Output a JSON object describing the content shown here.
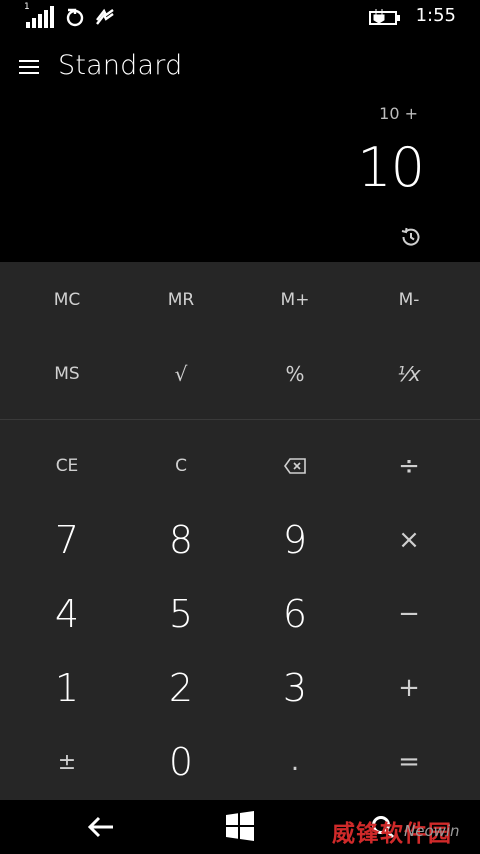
{
  "status_bar": {
    "signal_label": "1",
    "time": "1:55",
    "icons": [
      "signal-icon",
      "sync-icon",
      "data-sync-icon",
      "battery-charging-icon"
    ]
  },
  "header": {
    "menu_icon": "hamburger-icon",
    "title": "Standard"
  },
  "display": {
    "expression": "10 +",
    "result": "10",
    "history_icon": "history-icon"
  },
  "memory_keys": [
    "MC",
    "MR",
    "M+",
    "M-"
  ],
  "function_keys": [
    "MS",
    "√",
    "%",
    "¹⁄x"
  ],
  "keys": {
    "ce": "CE",
    "c": "C",
    "backspace_icon": "backspace-icon",
    "divide": "÷",
    "multiply": "×",
    "minus": "−",
    "plus": "+",
    "equals": "=",
    "negate": "±",
    "decimal": ".",
    "n0": "0",
    "n1": "1",
    "n2": "2",
    "n3": "3",
    "n4": "4",
    "n5": "5",
    "n6": "6",
    "n7": "7",
    "n8": "8",
    "n9": "9"
  },
  "nav_bar": {
    "icons": [
      "back-icon",
      "windows-start-icon",
      "search-icon"
    ]
  },
  "watermark": {
    "chinese": "威锋软件园",
    "brand": "Neowin"
  }
}
